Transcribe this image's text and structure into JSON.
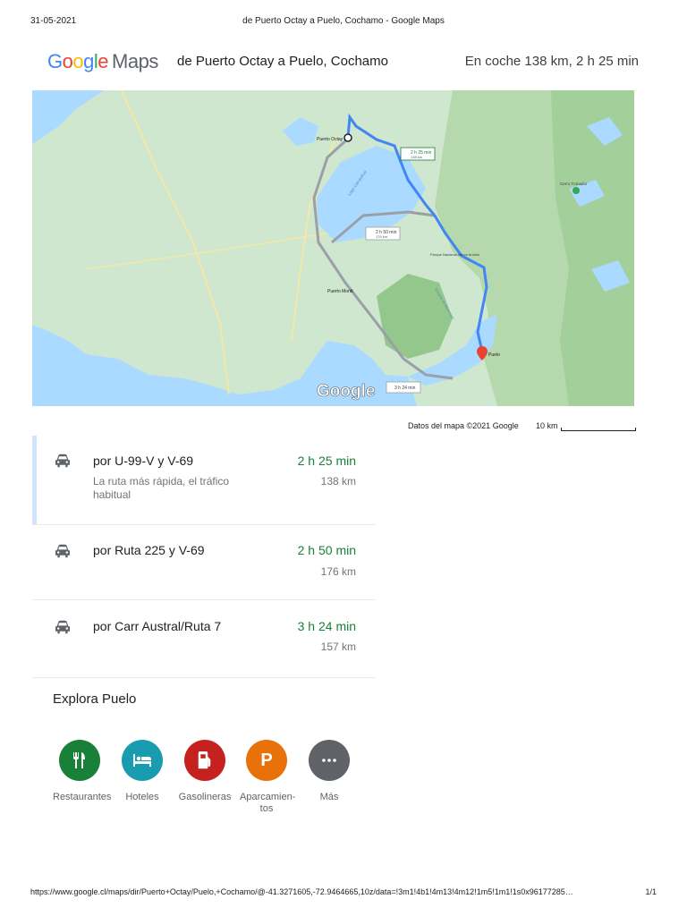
{
  "print": {
    "date": "31-05-2021",
    "title": "de Puerto Octay a Puelo, Cochamo - Google Maps",
    "url": "https://www.google.cl/maps/dir/Puerto+Octay/Puelo,+Cochamo/@-41.3271605,-72.9464665,10z/data=!3m1!4b1!4m13!4m12!1m5!1m1!1s0x96177285…",
    "page": "1/1"
  },
  "header": {
    "brand_google": "Google",
    "brand_maps": "Maps",
    "route_title": "de Puerto Octay a Puelo, Cochamo",
    "summary": "En coche 138 km, 2 h 25 min"
  },
  "map": {
    "labels": {
      "origin": "Puerto Octay",
      "destination": "Puelo",
      "city": "Puerto Montt",
      "lake": "Lago Llanquihue",
      "volcano": "Cerro Tronador",
      "park": "Parque Nacional Alerce Andino",
      "estuary": "Estuario de Reloncaví",
      "r1": "2 h 25 min",
      "r1_km": "138 km",
      "r2": "2 h 50 min",
      "r2_km": "176 km",
      "r3": "3 h 24 min",
      "watermark": "Google"
    },
    "colors": {
      "water": "#aadaff",
      "land": "#cfe6cf",
      "forest": "#a8d5a2",
      "route_primary": "#4285F4",
      "route_alt": "#9aa0a6"
    }
  },
  "map_footer": {
    "data": "Datos del mapa ©2021 Google",
    "scale": "10 km"
  },
  "routes": [
    {
      "via": "por U-99-V y V-69",
      "description": "La ruta más rápida, el tráfico habitual",
      "duration": "2 h 25 min",
      "distance": "138 km"
    },
    {
      "via": "por Ruta 225 y V-69",
      "duration": "2 h 50 min",
      "distance": "176 km"
    },
    {
      "via": "por Carr Austral/Ruta 7",
      "duration": "3 h 24 min",
      "distance": "157 km"
    }
  ],
  "explore": {
    "title": "Explora Puelo",
    "categories": [
      {
        "label": "Restaurantes",
        "icon": "restaurant-icon",
        "color": "#188038"
      },
      {
        "label": "Hoteles",
        "icon": "hotel-icon",
        "color": "#1a9cb0"
      },
      {
        "label": "Gasolineras",
        "icon": "gas-station-icon",
        "color": "#c5221f"
      },
      {
        "label": "Aparcamien-\ntos",
        "icon": "parking-icon",
        "color": "#e8710a"
      },
      {
        "label": "Más",
        "icon": "more-icon",
        "color": "#5f6368"
      }
    ]
  }
}
